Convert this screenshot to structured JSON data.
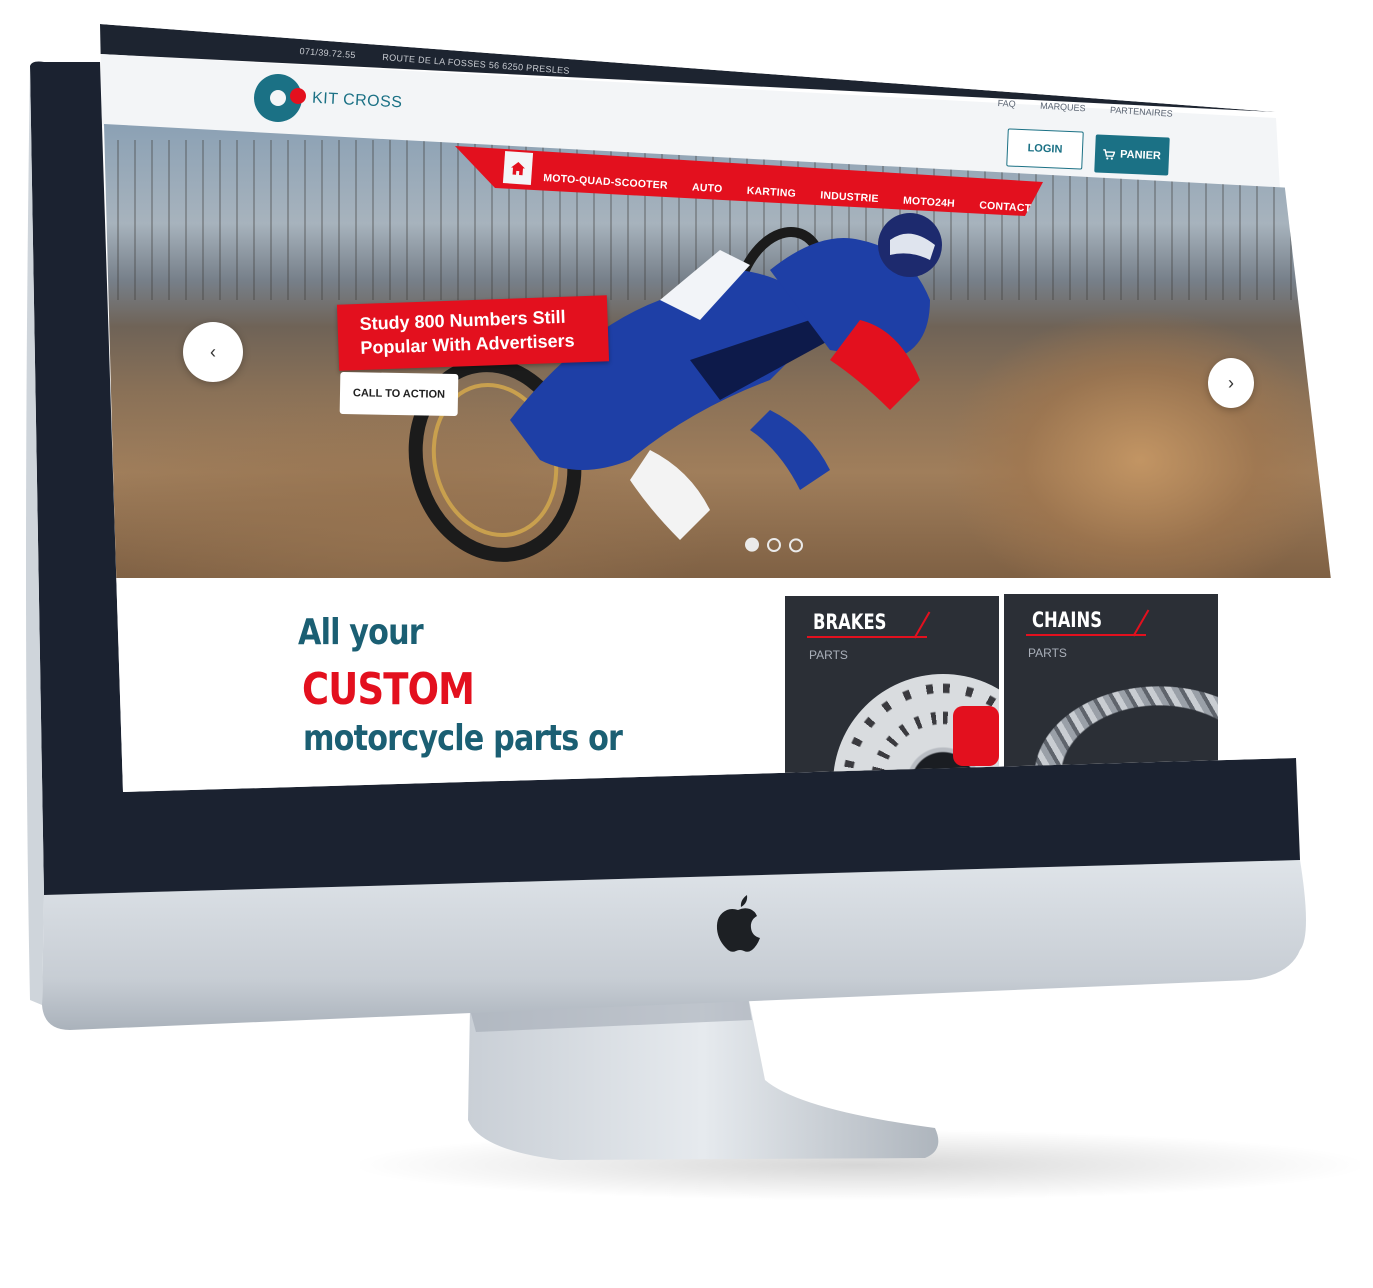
{
  "topbar": {
    "phone": "071/39.72.55",
    "address": "ROUTE DE LA FOSSES 56 6250 PRESLES"
  },
  "header": {
    "logo_text": "KIT CROSS",
    "utility_nav": [
      "FAQ",
      "MARQUES",
      "PARTENAIRES"
    ],
    "login_label": "LOGIN",
    "cart_label": "PANIER"
  },
  "main_nav": {
    "home_icon": "home-icon",
    "items": [
      "MOTO-QUAD-SCOOTER",
      "AUTO",
      "KARTING",
      "INDUSTRIE",
      "MOTO24H",
      "CONTACT"
    ]
  },
  "hero": {
    "headline": "Study 800 Numbers Still Popular With Advertisers",
    "cta_label": "CALL TO ACTION",
    "slides": 3,
    "active_slide": 1
  },
  "intro": {
    "line1": "All your",
    "line2": "CUSTOM",
    "line3": "motorcycle parts or"
  },
  "categories": [
    {
      "title": "BRAKES",
      "subtitle": "PARTS"
    },
    {
      "title": "CHAINS",
      "subtitle": "PARTS"
    }
  ],
  "colors": {
    "brand_teal": "#1b7185",
    "brand_red": "#e3101e",
    "dark": "#1d2430"
  }
}
